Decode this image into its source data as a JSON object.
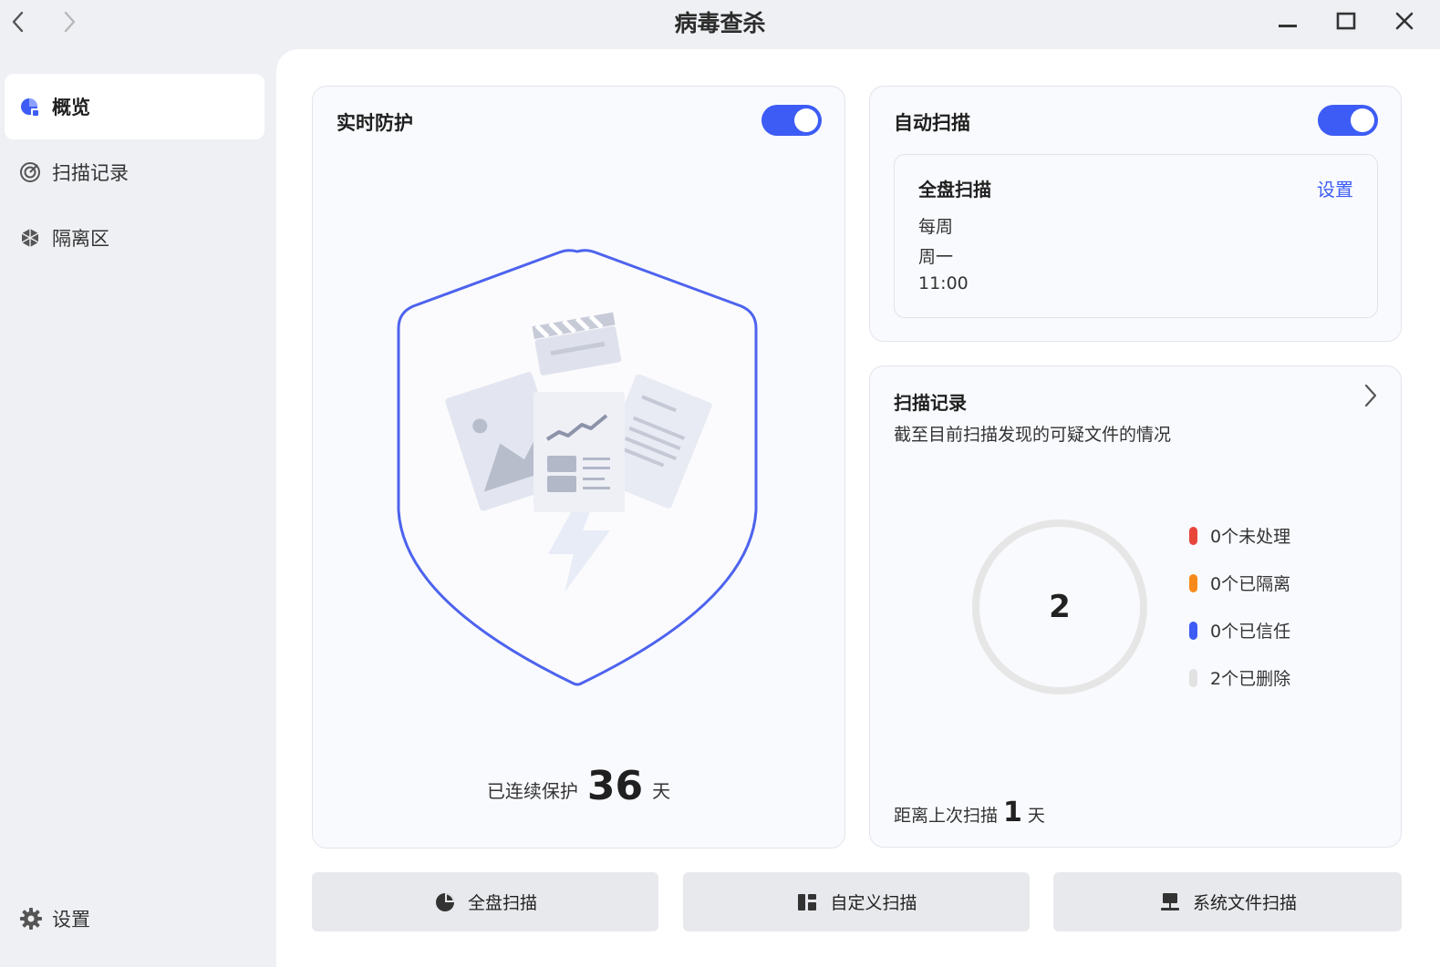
{
  "window": {
    "title": "病毒查杀"
  },
  "sidebar": {
    "items": [
      {
        "label": "概览",
        "icon": "overview-icon",
        "active": true
      },
      {
        "label": "扫描记录",
        "icon": "scan-record-icon",
        "active": false
      },
      {
        "label": "隔离区",
        "icon": "quarantine-icon",
        "active": false
      }
    ],
    "settings_label": "设置"
  },
  "realtime": {
    "title": "实时防护",
    "enabled": true,
    "protect_prefix": "已连续保护",
    "protect_days": "36",
    "protect_suffix": "天"
  },
  "auto_scan": {
    "title": "自动扫描",
    "enabled": true,
    "schedule": {
      "title": "全盘扫描",
      "link": "设置",
      "frequency": "每周",
      "day": "周一",
      "time": "11:00"
    }
  },
  "records": {
    "title": "扫描记录",
    "subtitle": "截至目前扫描发现的可疑文件的情况",
    "total": "2",
    "legend": [
      {
        "label": "0个未处理",
        "color": "#e8463a"
      },
      {
        "label": "0个已隔离",
        "color": "#f78a1a"
      },
      {
        "label": "0个已信任",
        "color": "#3d5cf5"
      },
      {
        "label": "2个已删除",
        "color": "#e2e2e2"
      }
    ],
    "last_prefix": "距离上次扫描",
    "last_days": "1",
    "last_suffix": "天"
  },
  "actions": {
    "full_scan": "全盘扫描",
    "custom_scan": "自定义扫描",
    "system_scan": "系统文件扫描"
  },
  "colors": {
    "accent": "#3d5cf5",
    "ring": "#e6e6e6"
  }
}
